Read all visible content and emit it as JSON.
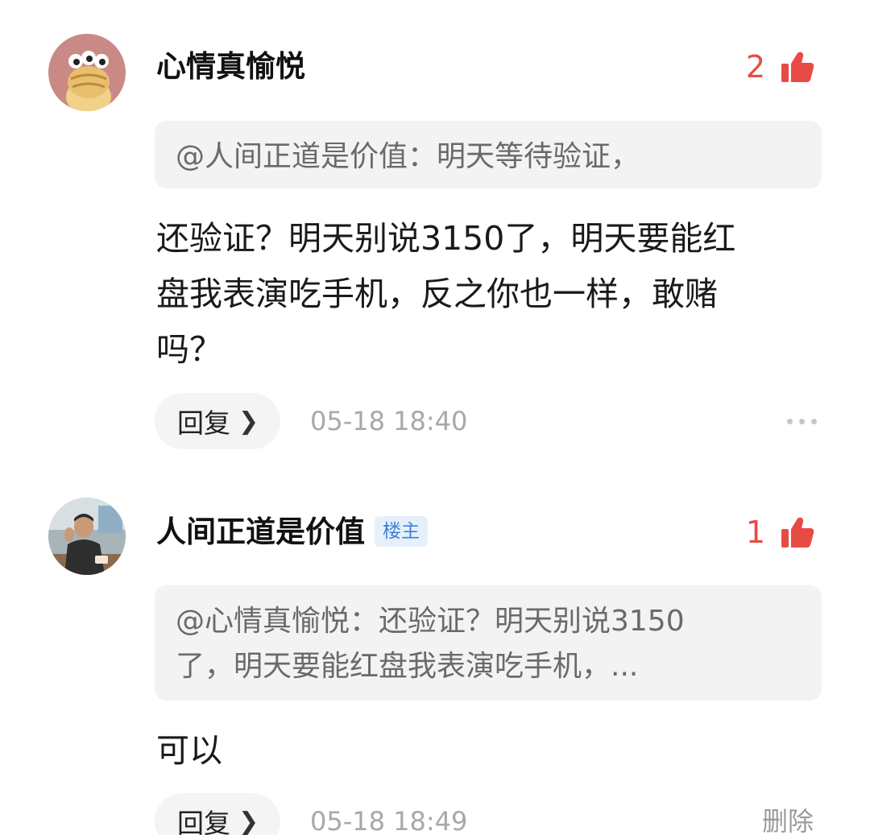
{
  "comments": [
    {
      "username": "心情真愉悦",
      "like_count": "2",
      "quote": "@人间正道是价值：明天等待验证，",
      "body_lines": [
        "还验证？明天别说3150了，明天要能红",
        "盘我表演吃手机，反之你也一样，敢赌",
        "吗？"
      ],
      "reply_label": "回复",
      "timestamp": "05-18 18:40",
      "avatar": "cartoon-creature-avatar"
    },
    {
      "username": "人间正道是价值",
      "badge": "楼主",
      "like_count": "1",
      "quote_lines": [
        "@心情真愉悦：还验证？明天别说3150",
        "了，明天要能红盘我表演吃手机，..."
      ],
      "body": "可以",
      "reply_label": "回复",
      "timestamp": "05-18 18:49",
      "delete_label": "删除",
      "avatar": "photo-avatar"
    }
  ],
  "icons": {
    "like": "thumbs-up-icon",
    "more": "more-dots-icon",
    "chevron": "chevron-right-icon"
  },
  "colors": {
    "like_accent": "#e84b44",
    "badge_text": "#3f7fd6",
    "badge_bg": "#e6f0fb",
    "quote_bg": "#f3f3f3"
  }
}
